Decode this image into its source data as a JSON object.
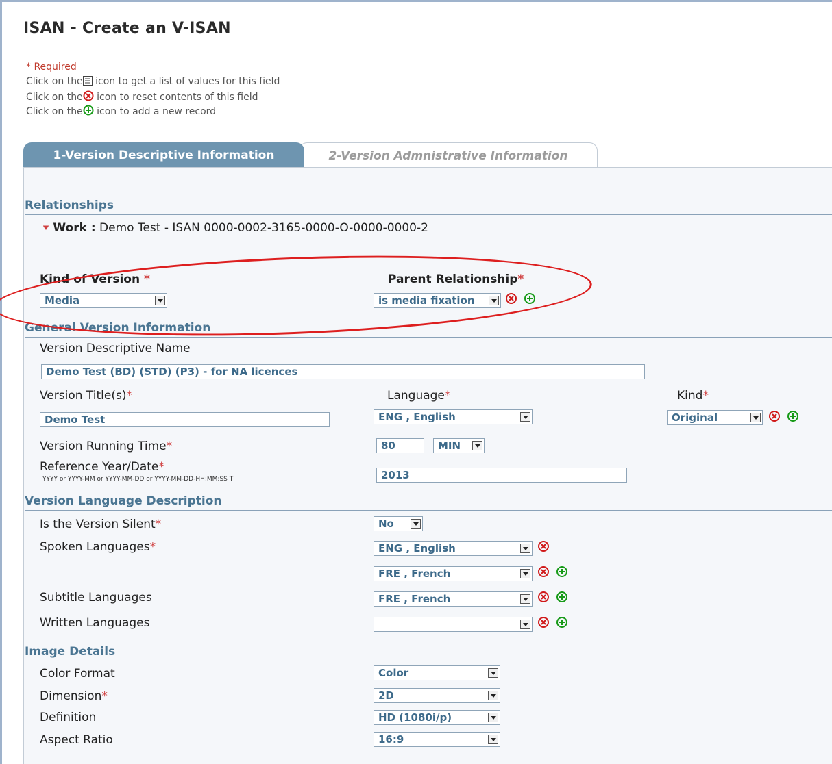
{
  "page": {
    "title": "ISAN - Create an V-ISAN",
    "help_required": "* Required",
    "help_list_prefix": "Click on the",
    "help_list_suffix": " icon to get a list of values for this field",
    "help_reset_prefix": "Click on the",
    "help_reset_suffix": " icon to reset contents of this field",
    "help_add_prefix": "Click on the",
    "help_add_suffix": " icon to add a new record"
  },
  "tabs": [
    {
      "label": "1-Version Descriptive Information",
      "active": true
    },
    {
      "label": "2-Version Admnistrative Information",
      "active": false
    }
  ],
  "relationships": {
    "heading": "Relationships",
    "work_label": "Work :",
    "work_value": "Demo Test - ISAN 0000-0002-3165-0000-O-0000-0000-2",
    "kind_label": "Kind of Version",
    "kind_value": "Media",
    "parent_label": "Parent Relationship",
    "parent_value": "is media fixation"
  },
  "general": {
    "heading": "General Version Information",
    "desc_name_label": "Version Descriptive Name",
    "desc_name_value": "Demo Test (BD) (STD) (P3) - for NA licences",
    "title_label": "Version Title(s)",
    "title_value": "Demo Test",
    "language_label": "Language",
    "language_value": "ENG , English",
    "kind_label": "Kind",
    "kind_value": "Original",
    "running_label": "Version Running Time",
    "running_value": "80",
    "running_unit": "MIN",
    "ref_label": "Reference Year/Date",
    "ref_format": "YYYY or YYYY-MM or YYYY-MM-DD or YYYY-MM-DD-HH:MM:SS T",
    "ref_value": "2013"
  },
  "language_desc": {
    "heading": "Version Language Description",
    "silent_label": "Is the Version Silent",
    "silent_value": "No",
    "spoken_label": "Spoken Languages",
    "spoken_values": [
      "ENG , English",
      "FRE , French"
    ],
    "subtitle_label": "Subtitle Languages",
    "subtitle_value": "FRE , French",
    "written_label": "Written Languages",
    "written_value": ""
  },
  "image": {
    "heading": "Image Details",
    "color_label": "Color Format",
    "color_value": "Color",
    "dimension_label": "Dimension",
    "dimension_value": "2D",
    "definition_label": "Definition",
    "definition_value": "HD (1080i/p)",
    "aspect_label": "Aspect Ratio",
    "aspect_value": "16:9"
  },
  "colors": {
    "accent": "#6e95b0",
    "section": "#4a7592",
    "required": "#d04040",
    "annotation": "#dd1f1f"
  },
  "icons": {
    "list": "list-icon",
    "reset": "reset-icon",
    "add": "add-icon"
  }
}
